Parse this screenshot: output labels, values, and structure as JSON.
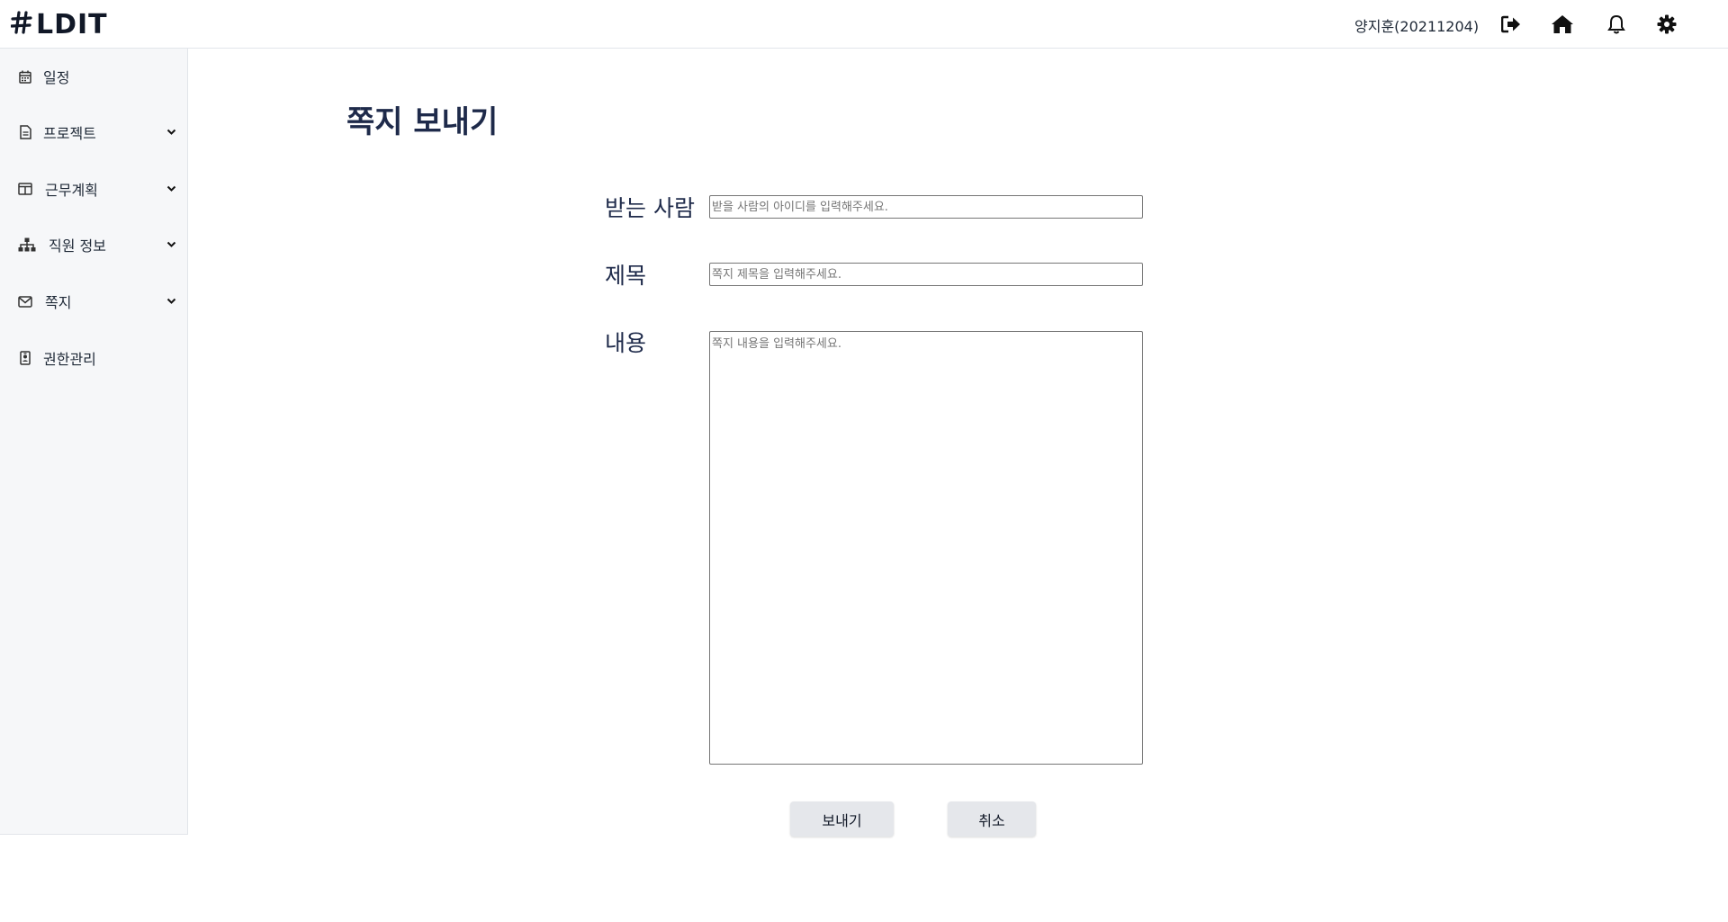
{
  "app": {
    "logo_text": "LDIT",
    "user": "양지훈(20211204)"
  },
  "header_icons": [
    "logout-icon",
    "home-icon",
    "bell-icon",
    "gear-icon"
  ],
  "sidebar": {
    "items": [
      {
        "label": "일정",
        "icon": "calendar-icon",
        "expandable": false
      },
      {
        "label": "프로젝트",
        "icon": "document-icon",
        "expandable": true
      },
      {
        "label": "근무계획",
        "icon": "table-icon",
        "expandable": true
      },
      {
        "label": "직원 정보",
        "icon": "org-chart-icon",
        "expandable": true
      },
      {
        "label": "쪽지",
        "icon": "envelope-icon",
        "expandable": true
      },
      {
        "label": "권한관리",
        "icon": "id-badge-icon",
        "expandable": false
      }
    ]
  },
  "main": {
    "title": "쪽지 보내기",
    "fields": {
      "recipient_label": "받는 사람",
      "recipient_placeholder": "받을 사람의 아이디를 입력해주세요.",
      "recipient_value": "",
      "subject_label": "제목",
      "subject_placeholder": "쪽지 제목을 입력해주세요.",
      "subject_value": "",
      "content_label": "내용",
      "content_placeholder": "쪽지 내용을 입력해주세요.",
      "content_value": ""
    },
    "buttons": {
      "send": "보내기",
      "cancel": "취소"
    }
  }
}
